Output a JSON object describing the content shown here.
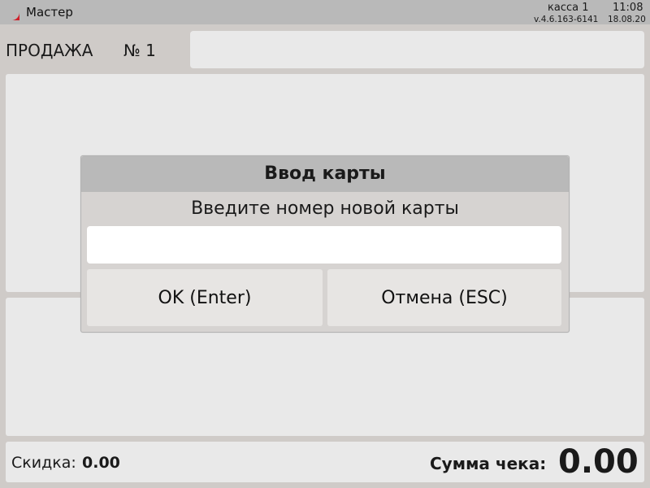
{
  "titlebar": {
    "app_title": "Мастер",
    "register": "касса 1",
    "time": "11:08",
    "version": "v.4.6.163-6141",
    "date": "18.08.20",
    "logo_icon": "app-logo-icon",
    "accent": "#d0202a"
  },
  "sale": {
    "label": "ПРОДАЖА",
    "number": "№ 1"
  },
  "dialog": {
    "title": "Ввод карты",
    "prompt": "Введите номер новой карты",
    "input_value": "",
    "ok_label": "OK (Enter)",
    "cancel_label": "Отмена (ESC)"
  },
  "footer": {
    "discount_label": "Скидка:",
    "discount_value": "0.00",
    "total_label": "Сумма чека:",
    "total_value": "0.00"
  }
}
